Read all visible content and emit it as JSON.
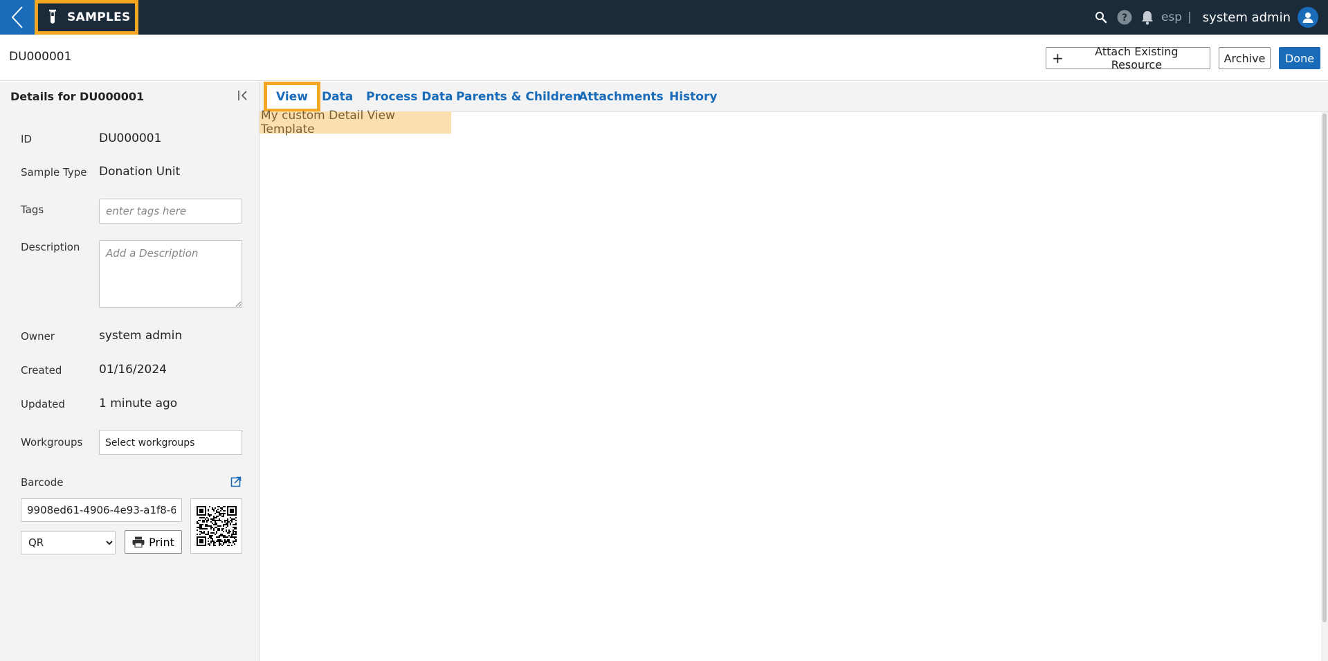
{
  "topbar": {
    "app_label": "SAMPLES",
    "org": "esp",
    "separator": "|",
    "user_name": "system admin",
    "icons": [
      "chevron-left-icon",
      "test-tube-icon",
      "search-icon",
      "help-icon",
      "bell-icon",
      "user-avatar-icon"
    ],
    "accent_color": "#f5a623",
    "bar_color": "#1b2b3a",
    "brand_color": "#1a6bb8"
  },
  "header": {
    "title": "DU000001",
    "attach_label": "Attach Existing Resource",
    "archive_label": "Archive",
    "done_label": "Done"
  },
  "sidebar": {
    "title": "Details for DU000001",
    "id_label": "ID",
    "id_value": "DU000001",
    "sample_type_label": "Sample Type",
    "sample_type_value": "Donation Unit",
    "tags_label": "Tags",
    "tags_placeholder": "enter tags here",
    "description_label": "Description",
    "description_placeholder": "Add a Description",
    "owner_label": "Owner",
    "owner_value": "system admin",
    "created_label": "Created",
    "created_value": "01/16/2024",
    "updated_label": "Updated",
    "updated_value": "1 minute ago",
    "workgroups_label": "Workgroups",
    "workgroups_value": "Select workgroups",
    "barcode_label": "Barcode",
    "barcode_value": "9908ed61-4906-4e93-a1f8-6",
    "barcode_type": "QR",
    "print_label": "Print"
  },
  "tabs": [
    {
      "label": "View",
      "active": true
    },
    {
      "label": "Data",
      "active": false
    },
    {
      "label": "Process Data",
      "active": false
    },
    {
      "label": "Parents & Children",
      "active": false
    },
    {
      "label": "Attachments",
      "active": false
    },
    {
      "label": "History",
      "active": false
    }
  ],
  "content": {
    "template_text": "My custom Detail View Template"
  }
}
